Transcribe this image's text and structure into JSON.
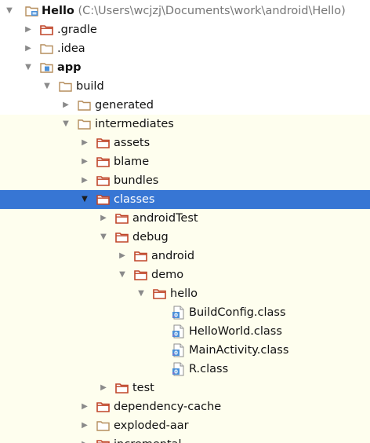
{
  "project_tree": {
    "root": {
      "label": "Hello",
      "path": "(C:\\Users\\wcjzj\\Documents\\work\\android\\Hello)"
    },
    "nodes": [
      {
        "id": "gradle",
        "label": ".gradle",
        "icon": "folder-orange-icon",
        "arrow": "collapsed",
        "level": 1
      },
      {
        "id": "idea",
        "label": ".idea",
        "icon": "folder-plain-icon",
        "arrow": "collapsed",
        "level": 1
      },
      {
        "id": "app",
        "label": "app",
        "icon": "module-folder-icon",
        "arrow": "expanded",
        "level": 1,
        "bold": true
      },
      {
        "id": "build",
        "label": "build",
        "icon": "folder-plain-icon",
        "arrow": "expanded",
        "level": 2
      },
      {
        "id": "generated",
        "label": "generated",
        "icon": "folder-plain-icon",
        "arrow": "collapsed",
        "level": 3
      },
      {
        "id": "intermediates",
        "label": "intermediates",
        "icon": "folder-plain-icon",
        "arrow": "expanded",
        "level": 3
      },
      {
        "id": "assets",
        "label": "assets",
        "icon": "folder-orange-icon",
        "arrow": "collapsed",
        "level": 4
      },
      {
        "id": "blame",
        "label": "blame",
        "icon": "folder-orange-icon",
        "arrow": "collapsed",
        "level": 4
      },
      {
        "id": "bundles",
        "label": "bundles",
        "icon": "folder-orange-icon",
        "arrow": "collapsed",
        "level": 4
      },
      {
        "id": "classes",
        "label": "classes",
        "icon": "folder-orange-icon",
        "arrow": "expanded",
        "level": 4,
        "selected": true
      },
      {
        "id": "androidTest",
        "label": "androidTest",
        "icon": "folder-orange-icon",
        "arrow": "collapsed",
        "level": 5
      },
      {
        "id": "debug",
        "label": "debug",
        "icon": "folder-orange-icon",
        "arrow": "expanded",
        "level": 5
      },
      {
        "id": "android",
        "label": "android",
        "icon": "folder-orange-icon",
        "arrow": "collapsed",
        "level": 6
      },
      {
        "id": "demo",
        "label": "demo",
        "icon": "folder-orange-icon",
        "arrow": "expanded",
        "level": 6
      },
      {
        "id": "hello",
        "label": "hello",
        "icon": "folder-orange-icon",
        "arrow": "expanded",
        "level": 7
      },
      {
        "id": "buildconfig",
        "label": "BuildConfig.class",
        "icon": "class-file-icon",
        "arrow": "none",
        "level": 8
      },
      {
        "id": "helloworld",
        "label": "HelloWorld.class",
        "icon": "class-file-icon",
        "arrow": "none",
        "level": 8
      },
      {
        "id": "mainactivity",
        "label": "MainActivity.class",
        "icon": "class-file-icon",
        "arrow": "none",
        "level": 8
      },
      {
        "id": "rclass",
        "label": "R.class",
        "icon": "class-file-icon",
        "arrow": "none",
        "level": 8
      },
      {
        "id": "test",
        "label": "test",
        "icon": "folder-orange-icon",
        "arrow": "collapsed",
        "level": 5
      },
      {
        "id": "depcache",
        "label": "dependency-cache",
        "icon": "folder-orange-icon",
        "arrow": "collapsed",
        "level": 4
      },
      {
        "id": "explodedaar",
        "label": "exploded-aar",
        "icon": "folder-plain-icon",
        "arrow": "collapsed",
        "level": 4
      },
      {
        "id": "incremental",
        "label": "incremental",
        "icon": "folder-orange-icon",
        "arrow": "collapsed",
        "level": 4
      }
    ]
  },
  "colors": {
    "selection": "#3776d4",
    "row_highlight": "#fefeee",
    "folder_orange": "#c0462a",
    "folder_plain": "#b58e5d",
    "arrow": "#8a8a8a"
  }
}
